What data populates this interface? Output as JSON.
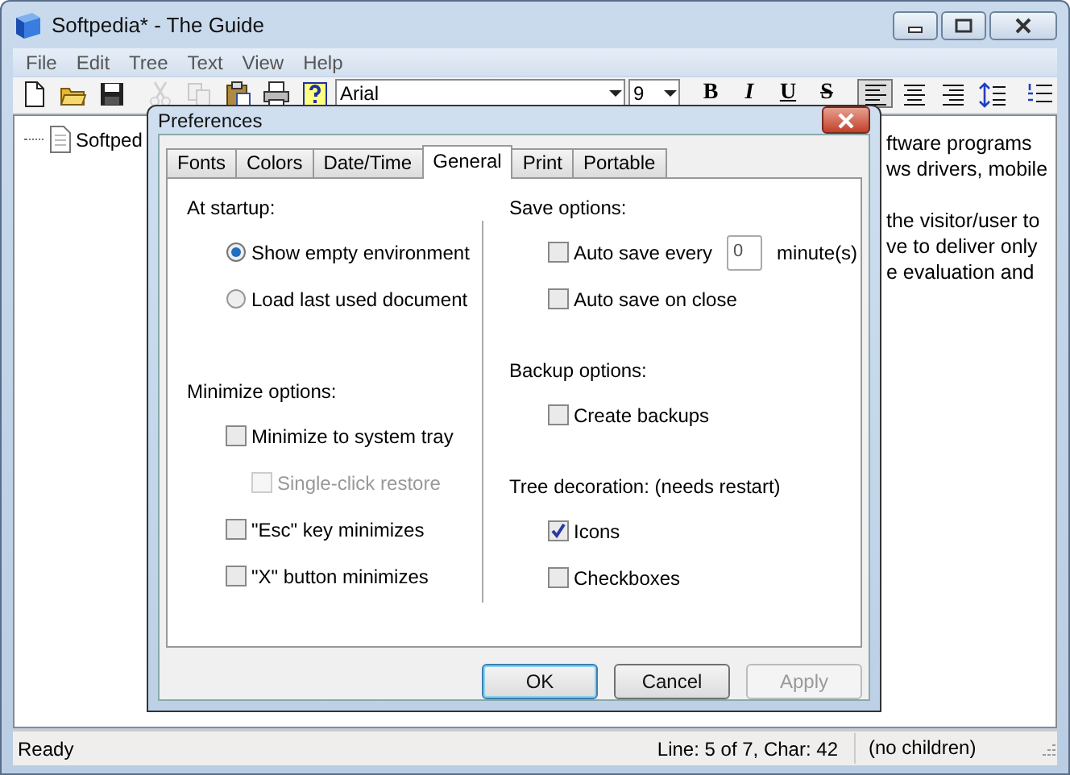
{
  "window": {
    "title": "Softpedia* - The Guide"
  },
  "menu": [
    "File",
    "Edit",
    "Tree",
    "Text",
    "View",
    "Help"
  ],
  "toolbar": [
    [
      {
        "kind": "icon",
        "disabled": false,
        "pressed": false
      },
      {
        "kind": "icon",
        "disabled": false,
        "pressed": false
      },
      {
        "kind": "icon",
        "disabled": false,
        "pressed": false
      }
    ],
    [
      {
        "kind": "icon",
        "disabled": true,
        "pressed": false
      },
      {
        "kind": "icon",
        "disabled": true,
        "pressed": false
      },
      {
        "kind": "icon",
        "disabled": false,
        "pressed": false
      },
      {
        "kind": "icon",
        "disabled": false,
        "pressed": false
      },
      {
        "kind": "icon",
        "disabled": false,
        "pressed": false
      },
      {
        "kind": "combo",
        "value": "Arial"
      },
      {
        "kind": "combo",
        "value": "9"
      }
    ],
    [
      {
        "kind": "text",
        "label": "B",
        "pressed": false
      },
      {
        "kind": "text",
        "label": "I",
        "pressed": false
      },
      {
        "kind": "text",
        "label": "U",
        "pressed": false
      },
      {
        "kind": "text",
        "label": "S",
        "pressed": false
      }
    ],
    [
      {
        "kind": "icon",
        "disabled": false,
        "pressed": true
      },
      {
        "kind": "icon",
        "disabled": false,
        "pressed": false
      },
      {
        "kind": "icon",
        "disabled": false,
        "pressed": false
      },
      {
        "kind": "icon",
        "disabled": false,
        "pressed": false
      }
    ],
    [
      {
        "kind": "icon",
        "disabled": false,
        "pressed": false
      }
    ]
  ],
  "tree": [
    {
      "label": "Softped"
    }
  ],
  "text_paragraphs": [
    [
      "ftware programs",
      "ws drivers, mobile"
    ],
    [
      "the visitor/user to",
      "ve to deliver only",
      "e evaluation and"
    ]
  ],
  "dialog": {
    "title": "Preferences",
    "tabs": [
      {
        "label": "Fonts",
        "selected": false
      },
      {
        "label": "Colors",
        "selected": false
      },
      {
        "label": "Date/Time",
        "selected": false
      },
      {
        "label": "General",
        "selected": true
      },
      {
        "label": "Print",
        "selected": false
      },
      {
        "label": "Portable",
        "selected": false
      }
    ],
    "columns": [
      [
        {
          "heading": "At startup:",
          "options": [
            {
              "kind": "radio",
              "label": "Show empty environment",
              "selected": true
            },
            {
              "kind": "radio",
              "label": "Load last used document",
              "selected": false
            }
          ]
        },
        {
          "heading": "Minimize options:",
          "options": [
            {
              "kind": "checkbox",
              "label": "Minimize to system tray",
              "checked": false,
              "disabled": false,
              "children": [
                {
                  "kind": "checkbox",
                  "label": "Single-click restore",
                  "checked": false,
                  "disabled": true
                }
              ]
            },
            {
              "kind": "checkbox",
              "label": "\"Esc\" key minimizes",
              "checked": false,
              "disabled": false
            },
            {
              "kind": "checkbox",
              "label": "\"X\" button minimizes",
              "checked": false,
              "disabled": false
            }
          ]
        }
      ],
      [
        {
          "heading": "Save options:",
          "options": [
            {
              "kind": "checkbox_number",
              "label": "Auto save every",
              "checked": false,
              "disabled": false,
              "value": "0",
              "unit": "minute(s)"
            },
            {
              "kind": "checkbox",
              "label": "Auto save on close",
              "checked": false,
              "disabled": false
            }
          ]
        },
        {
          "heading": "Backup options:",
          "options": [
            {
              "kind": "checkbox",
              "label": "Create backups",
              "checked": false,
              "disabled": false
            }
          ]
        },
        {
          "heading": "Tree decoration: (needs restart)",
          "options": [
            {
              "kind": "checkbox",
              "label": "Icons",
              "checked": true,
              "disabled": false
            },
            {
              "kind": "checkbox",
              "label": "Checkboxes",
              "checked": false,
              "disabled": false
            }
          ]
        }
      ]
    ],
    "buttons": [
      {
        "label": "OK",
        "default": true,
        "disabled": false
      },
      {
        "label": "Cancel",
        "default": false,
        "disabled": false
      },
      {
        "label": "Apply",
        "default": false,
        "disabled": true
      }
    ]
  },
  "status_bar": {
    "message": "Ready",
    "position": "Line: 5 of 7, Char: 42",
    "info": "(no children)"
  }
}
